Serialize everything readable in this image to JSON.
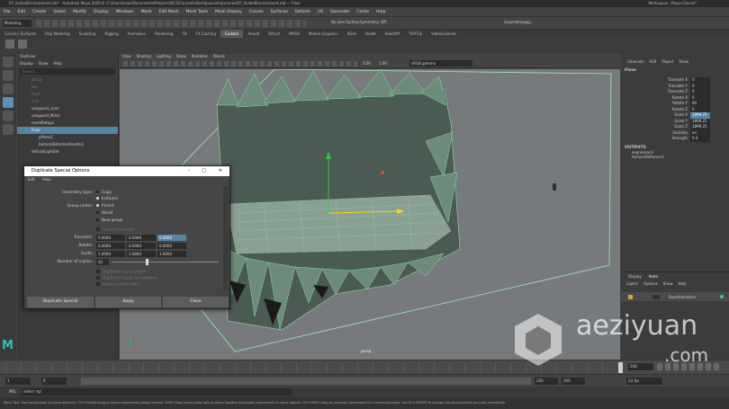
{
  "window": {
    "title": "07_ScaledEnvironment.mb* - Autodesk Maya 2020.4: C:\\Users\\Isaac\\Documents\\Projects\\DCS\\CourseFolder\\Spaceship\\scenes\\07_ScaledEnvironment.mb --- Floor",
    "workspace_label": "Workspace : Maya Classic*"
  },
  "menubar": [
    "File",
    "Edit",
    "Create",
    "Select",
    "Modify",
    "Display",
    "Windows",
    "Mesh",
    "Edit Mesh",
    "Mesh Tools",
    "Mesh Display",
    "Curves",
    "Surfaces",
    "Deform",
    "UV",
    "Generate",
    "Cache",
    "Help"
  ],
  "statusline": {
    "mode": "Modeling",
    "live_surface": "No Live Surface",
    "symmetry": "Symmetry: Off",
    "user": "isaacmilley@g..."
  },
  "shelf_tabs": [
    "Curves / Surfaces",
    "Poly Modeling",
    "Sculpting",
    "Rigging",
    "Animation",
    "Rendering",
    "FX",
    "FX Caching",
    "Custom",
    "Arnold",
    "Bifrost",
    "MASH",
    "Motion Graphics",
    "XGen",
    "Bullet",
    "Redshift",
    "TURTLE",
    "VideoCaliente"
  ],
  "shelf_active": "Custom",
  "outliner": {
    "title": "Outliner",
    "menu": [
      "Display",
      "Show",
      "Help"
    ],
    "search_placeholder": "Search...",
    "items": [
      "persp",
      "top",
      "front",
      "side",
      "vanguard_visor",
      "vanguard_Mesh",
      "meshRetopo",
      "Floor",
      "pPlane1",
      "textureDeformerHandle1",
      "defaultLightSet"
    ],
    "selected": "Floor"
  },
  "viewport": {
    "menu": [
      "View",
      "Shading",
      "Lighting",
      "Show",
      "Renderer",
      "Panels"
    ],
    "gamma": "sRGB gamma",
    "val1": "0.00",
    "val2": "1.00",
    "camera_label": "persp"
  },
  "channelbox": {
    "menu": [
      "Channels",
      "Edit",
      "Object",
      "Show"
    ],
    "object": "Floor",
    "attrs": [
      {
        "name": "Translate X",
        "value": "0"
      },
      {
        "name": "Translate Y",
        "value": "0"
      },
      {
        "name": "Translate Z",
        "value": "0"
      },
      {
        "name": "Rotate X",
        "value": "0"
      },
      {
        "name": "Rotate Y",
        "value": "90"
      },
      {
        "name": "Rotate Z",
        "value": "0"
      },
      {
        "name": "Scale X",
        "value": "1899.25"
      },
      {
        "name": "Scale Y",
        "value": "1899.25"
      },
      {
        "name": "Scale Z",
        "value": "1899.25"
      },
      {
        "name": "Visibility",
        "value": "on"
      },
      {
        "name": "Strength",
        "value": "0.4"
      }
    ],
    "outputs_label": "OUTPUTS",
    "outputs": [
      "expression1",
      "textureDeformer1"
    ]
  },
  "layers": {
    "tabs": [
      "Display",
      "Anim"
    ],
    "menu": [
      "Layers",
      "Options",
      "Show",
      "Help"
    ],
    "layer_name": "BaseAnimation"
  },
  "dialog": {
    "title": "Duplicate Special Options",
    "menu": [
      "Edit",
      "Help"
    ],
    "geometry_type_label": "Geometry type:",
    "geometry_types": [
      "Copy",
      "Instance"
    ],
    "group_under_label": "Group under:",
    "group_under": [
      "Parent",
      "World",
      "New group"
    ],
    "smart_transform": "Smart transform",
    "translate_label": "Translate:",
    "translate": [
      "0.0000",
      "0.0000",
      "0.0000"
    ],
    "rotate_label": "Rotate:",
    "rotate": [
      "0.0000",
      "0.0000",
      "0.0000"
    ],
    "scale_label": "Scale:",
    "scale": [
      "1.0000",
      "1.0000",
      "1.0000"
    ],
    "copies_label": "Number of copies:",
    "copies": "22",
    "checkboxes": [
      "Duplicate input graph",
      "Duplicate input connections",
      "Instance leaf nodes",
      "Assign unique name to child nodes"
    ],
    "buttons": [
      "Duplicate Special",
      "Apply",
      "Close"
    ]
  },
  "timeline": {
    "start": "1",
    "end": "200",
    "current": "200",
    "range_start": "0",
    "range_end": "200",
    "anim_end": "200",
    "fps": "24 fps"
  },
  "mel": {
    "label": "MEL",
    "command": "select -tgl"
  },
  "helpline": "Move Tool: Use manipulator to move object(s). Ctrl+middle-drag to move components along normals. Shift+drag manipulator axis or plane handles to extrude components or clone objects. Ctrl+Shift+drag to constrain movement to a connected edge. Use D or INSERT to change the pivot position and axis orientation.",
  "watermark": {
    "line1": "aeziyuan",
    "line2": ".com"
  },
  "colors": {
    "mesh": "#86e0a8",
    "selection": "#5285a6",
    "viewport_bg": "#777a7d"
  }
}
